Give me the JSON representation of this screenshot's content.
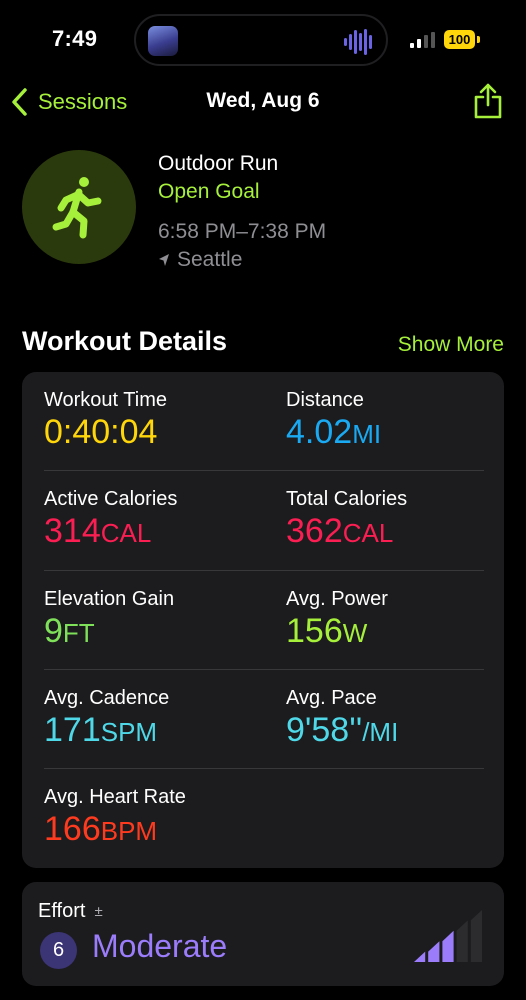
{
  "status_bar": {
    "time": "7:49",
    "battery": "100"
  },
  "nav": {
    "back_label": "Sessions",
    "title": "Wed, Aug 6"
  },
  "workout": {
    "type": "Outdoor Run",
    "goal": "Open Goal",
    "time_range": "6:58 PM–7:38 PM",
    "location": "Seattle"
  },
  "details": {
    "title": "Workout Details",
    "show_more": "Show More",
    "metrics": [
      {
        "label": "Workout Time",
        "value": "0:40:04",
        "unit": "",
        "color": "#ffd60a"
      },
      {
        "label": "Distance",
        "value": "4.02",
        "unit": "MI",
        "color": "#1aaaf3"
      },
      {
        "label": "Active Calories",
        "value": "314",
        "unit": "CAL",
        "color": "#fa1e52"
      },
      {
        "label": "Total Calories",
        "value": "362",
        "unit": "CAL",
        "color": "#fa1e52"
      },
      {
        "label": "Elevation Gain",
        "value": "9",
        "unit": "FT",
        "color": "#7fe05a"
      },
      {
        "label": "Avg. Power",
        "value": "156",
        "unit": "W",
        "color": "#a6f03b"
      },
      {
        "label": "Avg. Cadence",
        "value": "171",
        "unit": "SPM",
        "color": "#4fd8e8"
      },
      {
        "label": "Avg. Pace",
        "value": "9'58''",
        "unit": "/MI",
        "color": "#4fd8e8"
      },
      {
        "label": "Avg. Heart Rate",
        "value": "166",
        "unit": "BPM",
        "color": "#ff3b1f"
      }
    ]
  },
  "effort": {
    "label": "Effort",
    "adjust_symbol": "±",
    "score": "6",
    "level": "Moderate",
    "bars_filled": 3,
    "bars_total": 5
  },
  "colors": {
    "accent": "#a6f03b",
    "effort": "#9b7dfc",
    "card": "#1c1c1e"
  },
  "icons": [
    "chevron-left-icon",
    "share-icon",
    "running-figure-icon",
    "location-arrow-icon",
    "effort-bars-icon",
    "signal-icon",
    "battery-icon"
  ]
}
